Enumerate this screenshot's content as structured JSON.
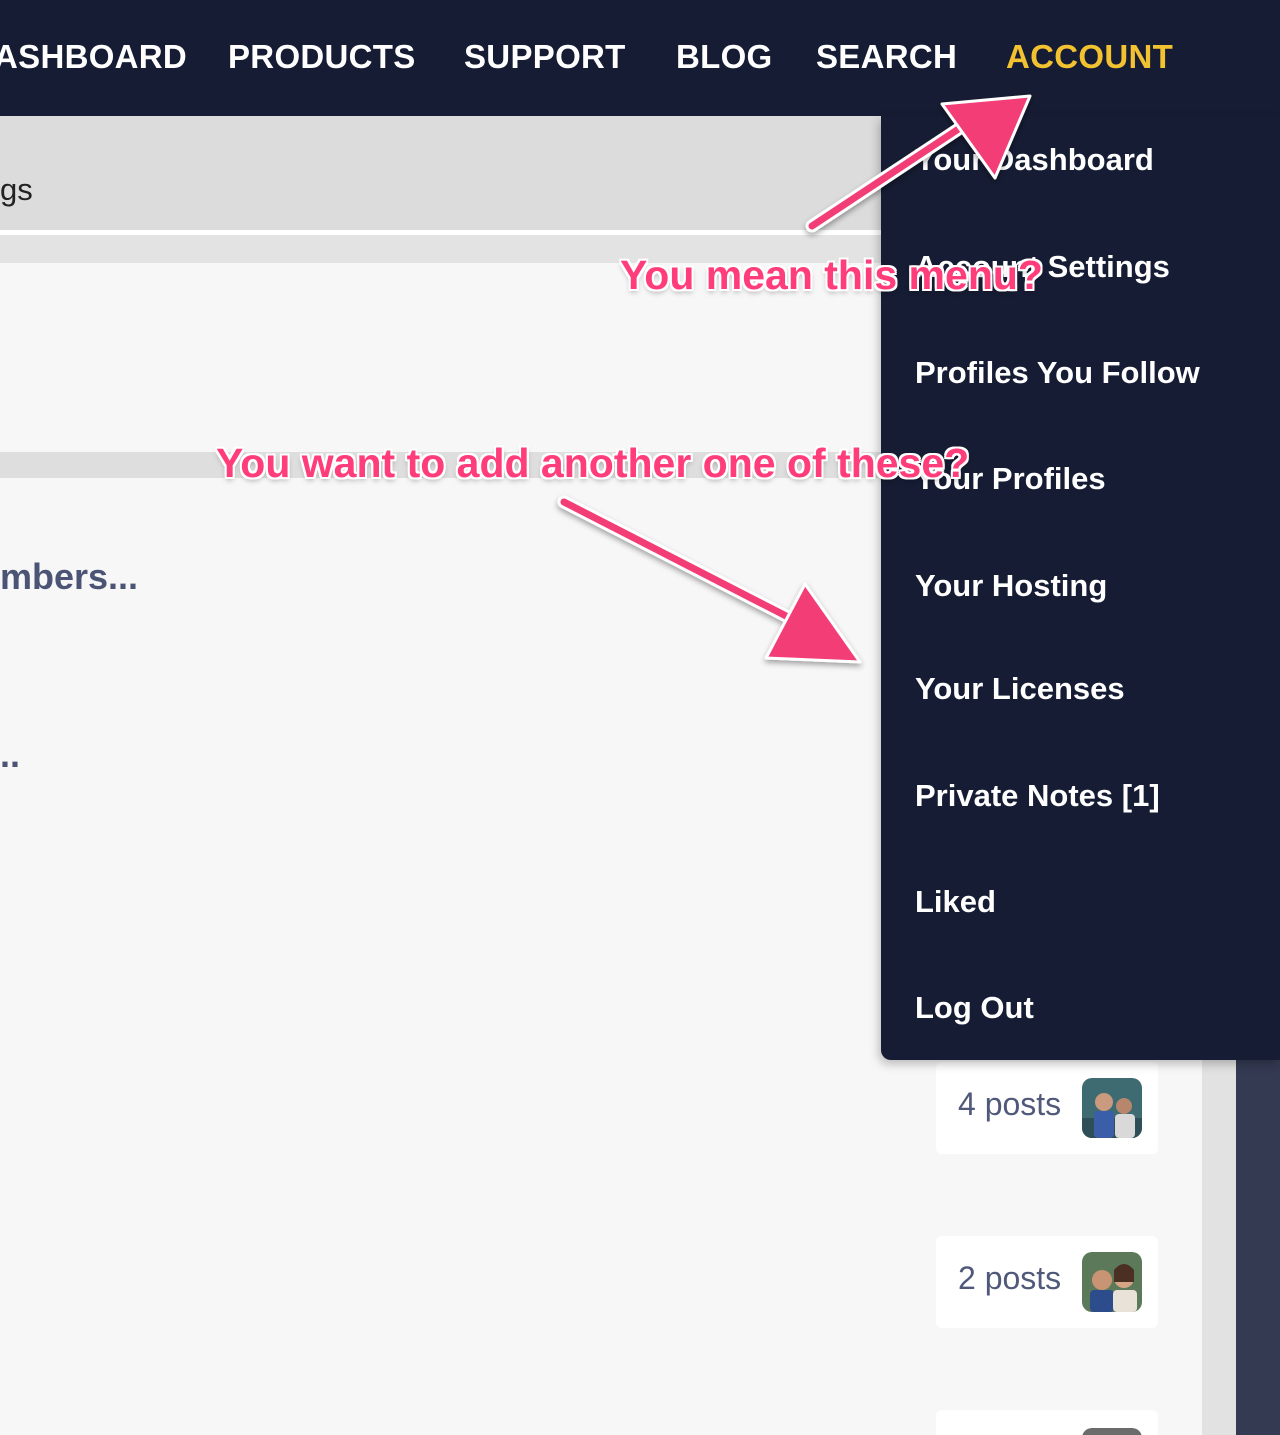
{
  "topnav": {
    "items": [
      {
        "label": "ASHBOARD",
        "active": false
      },
      {
        "label": "PRODUCTS",
        "active": false
      },
      {
        "label": "SUPPORT",
        "active": false
      },
      {
        "label": "BLOG",
        "active": false
      },
      {
        "label": "SEARCH",
        "active": false
      },
      {
        "label": "ACCOUNT",
        "active": true
      }
    ],
    "active_color": "#f2c230",
    "background": "#161c33"
  },
  "content": {
    "bar_text": "gs",
    "members_text": "mbers...",
    "ellipsis_text": ".."
  },
  "dropdown": {
    "items": [
      {
        "label": "Your Dashboard"
      },
      {
        "label": "Account Settings"
      },
      {
        "label": "Profiles You Follow"
      },
      {
        "label": "Your Profiles"
      },
      {
        "label": "Your Hosting"
      },
      {
        "label": "Your Licenses"
      },
      {
        "label": "Private Notes [1]"
      },
      {
        "label": "Liked"
      },
      {
        "label": "Log Out"
      }
    ]
  },
  "posts": [
    {
      "count": "4 posts",
      "avatar": "user-avatar-icon"
    },
    {
      "count": "2 posts",
      "avatar": "user-avatar-icon"
    }
  ],
  "annotations": {
    "menu_question": "You mean this menu?",
    "add_question": "You want to add another one of these?",
    "color": "#ff3d7a"
  }
}
